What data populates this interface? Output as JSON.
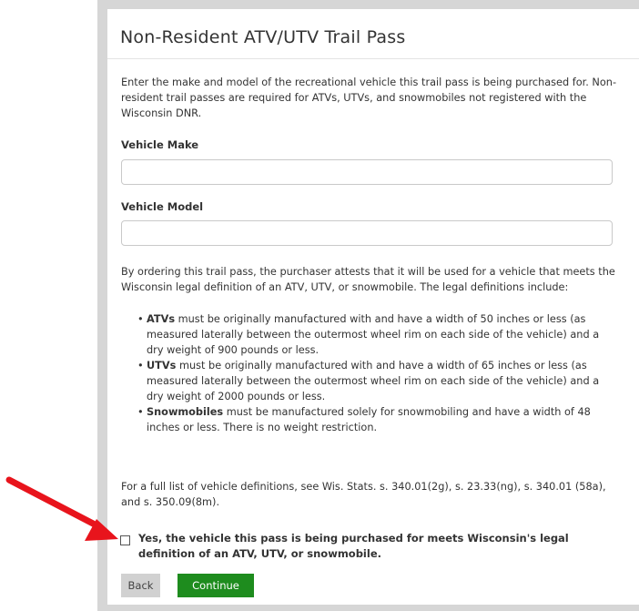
{
  "header": {
    "title": "Non-Resident ATV/UTV Trail Pass"
  },
  "intro": "Enter the make and model of the recreational vehicle this trail pass is being purchased for. Non-resident trail passes are required for ATVs, UTVs, and snowmobiles not registered with the Wisconsin DNR.",
  "fields": {
    "make_label": "Vehicle Make",
    "make_value": "",
    "model_label": "Vehicle Model",
    "model_value": ""
  },
  "attestation": "By ordering this trail pass, the purchaser attests that it will be used for a vehicle that meets the Wisconsin legal definition of an ATV, UTV, or snowmobile. The legal definitions include:",
  "definitions": [
    {
      "term": "ATVs",
      "text": " must be originally manufactured with and have a width of 50 inches or less (as measured laterally between the outermost wheel rim on each side of the vehicle) and a dry weight of 900 pounds or less."
    },
    {
      "term": "UTVs",
      "text": " must be originally manufactured with and have a width of 65 inches or less (as measured laterally between the outermost wheel rim on each side of the vehicle) and a dry weight of 2000 pounds or less."
    },
    {
      "term": "Snowmobiles",
      "text": " must be manufactured solely for snowmobiling and have a width of 48 inches or less. There is no weight restriction."
    }
  ],
  "full_list": "For a full list of vehicle definitions, see Wis. Stats. s. 340.01(2g), s. 23.33(ng), s. 340.01 (58a), and s. 350.09(8m).",
  "confirm": {
    "checked": false,
    "label": "Yes, the vehicle this pass is being purchased for meets Wisconsin's legal definition of an ATV, UTV, or snowmobile."
  },
  "buttons": {
    "back": "Back",
    "continue": "Continue"
  },
  "colors": {
    "continue_bg": "#1e8c1e",
    "back_bg": "#d1d1d1",
    "arrow": "#e8141c"
  }
}
